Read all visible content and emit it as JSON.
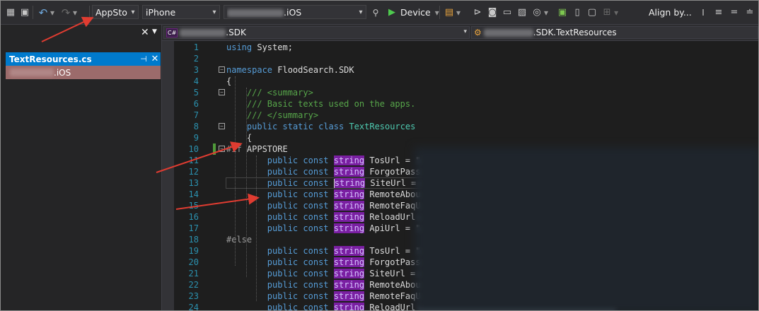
{
  "toolbar": {
    "config_combo": "AppStore",
    "platform_combo": "iPhone",
    "project_combo_suffix": ".iOS",
    "run_label": "Device",
    "align_label": "Align by..."
  },
  "left_panel": {
    "file_tab_label": "TextResources.cs",
    "file_item_suffix": ".iOS"
  },
  "nav_bar": {
    "left_combo_suffix": ".SDK",
    "right_combo_suffix": ".SDK.TextResources"
  },
  "code_lines": [
    {
      "n": "1",
      "text": "using System;"
    },
    {
      "n": "2",
      "text": ""
    },
    {
      "n": "3",
      "text": "namespace FloodSearch.SDK"
    },
    {
      "n": "4",
      "text": "{"
    },
    {
      "n": "5",
      "text": "    /// <summary>"
    },
    {
      "n": "6",
      "text": "    /// Basic texts used on the apps."
    },
    {
      "n": "7",
      "text": "    /// </summary>"
    },
    {
      "n": "8",
      "text": "    public static class TextResources"
    },
    {
      "n": "9",
      "text": "    {"
    },
    {
      "n": "10",
      "text": "#if APPSTORE"
    },
    {
      "n": "11",
      "text": "        public const string TosUrl = \""
    },
    {
      "n": "12",
      "text": "        public const string ForgotPass"
    },
    {
      "n": "13",
      "text": "        public const string SiteUrl ="
    },
    {
      "n": "14",
      "text": "        public const string RemoteAbou"
    },
    {
      "n": "15",
      "text": "        public const string RemoteFaqU"
    },
    {
      "n": "16",
      "text": "        public const string ReloadUrl"
    },
    {
      "n": "17",
      "text": "        public const string ApiUrl = \""
    },
    {
      "n": "18",
      "text": "#else"
    },
    {
      "n": "19",
      "text": "        public const string TosUrl = \""
    },
    {
      "n": "20",
      "text": "        public const string ForgotPass"
    },
    {
      "n": "21",
      "text": "        public const string SiteUrl ="
    },
    {
      "n": "22",
      "text": "        public const string RemoteAbou"
    },
    {
      "n": "23",
      "text": "        public const string RemoteFaqU"
    },
    {
      "n": "24",
      "text": "        public const string ReloadUrl"
    }
  ],
  "colors": {
    "keyword": "#569cd6",
    "comment": "#57a64a",
    "type": "#4ec9b0",
    "line_number": "#2b91af",
    "annotation_arrow": "#e03c31"
  }
}
